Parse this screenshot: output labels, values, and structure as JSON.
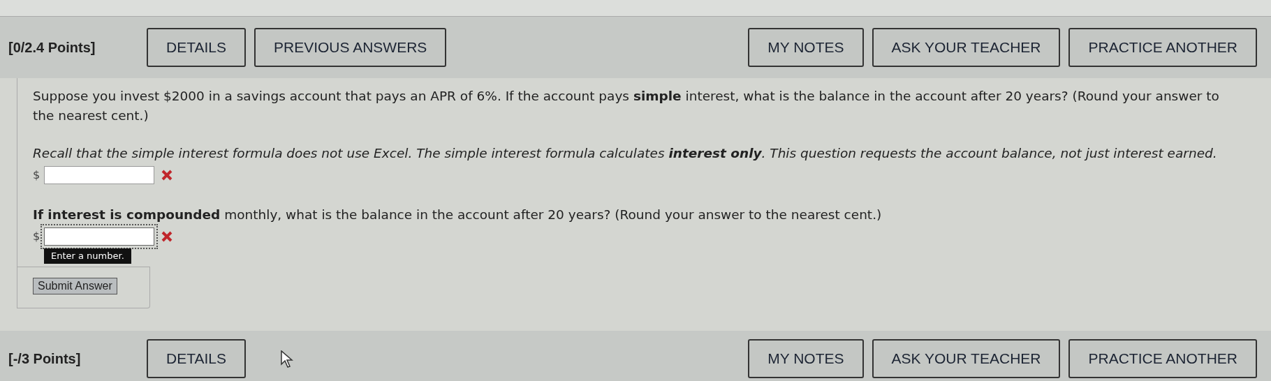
{
  "questions": [
    {
      "points": "[0/2.4 Points]",
      "left_buttons": [
        "DETAILS",
        "PREVIOUS ANSWERS"
      ],
      "right_buttons": [
        "MY NOTES",
        "ASK YOUR TEACHER",
        "PRACTICE ANOTHER"
      ],
      "parts": [
        {
          "kind": "text",
          "text": "Suppose you invest $2000 in a savings account that pays an APR of 6%. If the account pays **simple** interest, what is the balance in the account after 20 years? (Round your answer to the nearest cent.)"
        },
        {
          "kind": "hint",
          "text": "Recall that the simple interest formula does not use Excel. The simple interest formula calculates **interest only**. This question requests the account balance, not just interest earned."
        },
        {
          "kind": "answer",
          "prefix": "$",
          "correct": false,
          "focused": false
        },
        {
          "kind": "text",
          "text": "**If interest is compounded** monthly, what is the balance in the account after 20 years? (Round your answer to the nearest cent.)"
        },
        {
          "kind": "answer",
          "prefix": "$",
          "correct": false,
          "focused": true,
          "tooltip": "Enter a number."
        }
      ],
      "submit": "Submit Answer"
    },
    {
      "points": "[-/3 Points]",
      "left_buttons": [
        "DETAILS"
      ],
      "right_buttons": [
        "MY NOTES",
        "ASK YOUR TEACHER",
        "PRACTICE ANOTHER"
      ]
    }
  ]
}
